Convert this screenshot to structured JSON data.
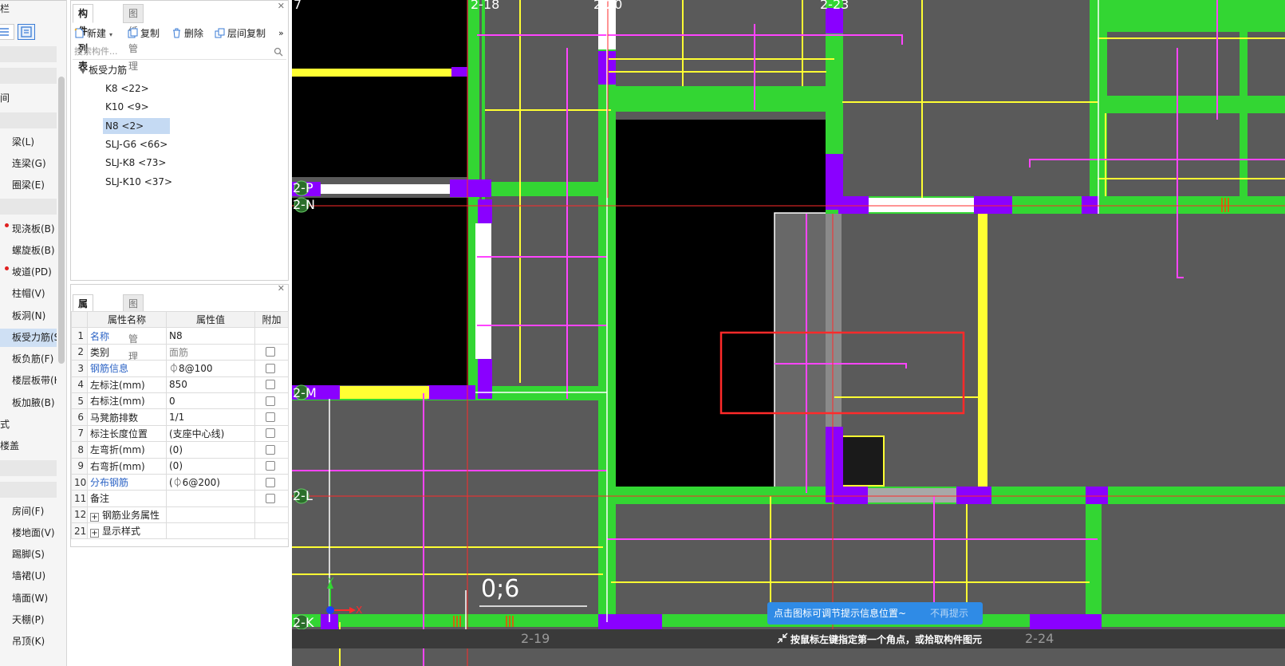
{
  "left_nav": {
    "partial_top_label": "栏",
    "items": [
      {
        "label": "梁(L)"
      },
      {
        "label": "连梁(G)"
      },
      {
        "label": "圈梁(E)"
      },
      {
        "label": "现浇板(B)"
      },
      {
        "label": "螺旋板(B)"
      },
      {
        "label": "坡道(PD)"
      },
      {
        "label": "柱帽(V)"
      },
      {
        "label": "板洞(N)"
      },
      {
        "label": "板受力筋(S"
      },
      {
        "label": "板负筋(F)"
      },
      {
        "label": "楼层板带(H"
      },
      {
        "label": "板加腋(B)"
      },
      {
        "label": "房间(F)"
      },
      {
        "label": "楼地面(V)"
      },
      {
        "label": "踢脚(S)"
      },
      {
        "label": "墙裙(U)"
      },
      {
        "label": "墙面(W)"
      },
      {
        "label": "天棚(P)"
      },
      {
        "label": "吊顶(K)"
      }
    ],
    "partial_labels": [
      "间",
      "式",
      "楼盖"
    ]
  },
  "component_panel": {
    "tabs": [
      "构件列表",
      "图纸管理"
    ],
    "active_tab": "构件列表",
    "toolbar": {
      "new_label": "新建",
      "copy_label": "复制",
      "delete_label": "删除",
      "floor_copy_label": "层间复制",
      "more_label": "»"
    },
    "search": {
      "placeholder": "搜索构件..."
    },
    "tree": {
      "root_label": "板受力筋",
      "items": [
        "K8 <22>",
        "K10 <9>",
        "N8 <2>",
        "SLJ-G6 <66>",
        "SLJ-K8 <73>",
        "SLJ-K10 <37>"
      ],
      "selected": "N8 <2>"
    }
  },
  "property_panel": {
    "tabs": [
      "属性列表",
      "图层管理"
    ],
    "active_tab": "属性列表",
    "headers": [
      "属性名称",
      "属性值",
      "附加"
    ],
    "rows": [
      {
        "num": "1",
        "name": "名称",
        "value": "N8",
        "checkbox": false
      },
      {
        "num": "2",
        "name": "类别",
        "value": "面筋",
        "checkbox": true
      },
      {
        "num": "3",
        "name": "钢筋信息",
        "value": "⏀8@100",
        "checkbox": true
      },
      {
        "num": "4",
        "name": "左标注(mm)",
        "value": "850",
        "checkbox": true
      },
      {
        "num": "5",
        "name": "右标注(mm)",
        "value": "0",
        "checkbox": true
      },
      {
        "num": "6",
        "name": "马凳筋排数",
        "value": "1/1",
        "checkbox": true
      },
      {
        "num": "7",
        "name": "标注长度位置",
        "value": "(支座中心线)",
        "checkbox": true
      },
      {
        "num": "8",
        "name": "左弯折(mm)",
        "value": "(0)",
        "checkbox": true
      },
      {
        "num": "9",
        "name": "右弯折(mm)",
        "value": "(0)",
        "checkbox": true
      },
      {
        "num": "10",
        "name": "分布钢筋",
        "value": "(⏀6@200)",
        "checkbox": true
      },
      {
        "num": "11",
        "name": "备注",
        "value": "",
        "checkbox": true
      },
      {
        "num": "12",
        "name": "钢筋业务属性",
        "value": "",
        "checkbox": false,
        "expandable": true
      },
      {
        "num": "21",
        "name": "显示样式",
        "value": "",
        "checkbox": false,
        "expandable": true
      }
    ]
  },
  "canvas": {
    "axis_labels_top": [
      "7",
      "2-18",
      "2-20",
      "2-23"
    ],
    "axis_labels_left": [
      "2-P",
      "2-N",
      "2-M",
      "2-L",
      "2-K"
    ],
    "axis_labels_bottom": [
      "2-19",
      "2-24"
    ],
    "dimension_text": "0;6",
    "coord_x_label": "X",
    "coord_y_label": "Y",
    "tip": {
      "text": "点击图标可调节提示信息位置~",
      "dismiss_label": "不再提示"
    },
    "status_text": "按鼠标左键指定第一个角点，或拾取构件图元",
    "colors": {
      "background": "#5a5a5a",
      "beam": "#33d633",
      "column": "#8a00ff",
      "rebar_yellow": "#ffff33",
      "rebar_magenta": "#ff44ff",
      "selection": "#ff2a2a"
    }
  }
}
